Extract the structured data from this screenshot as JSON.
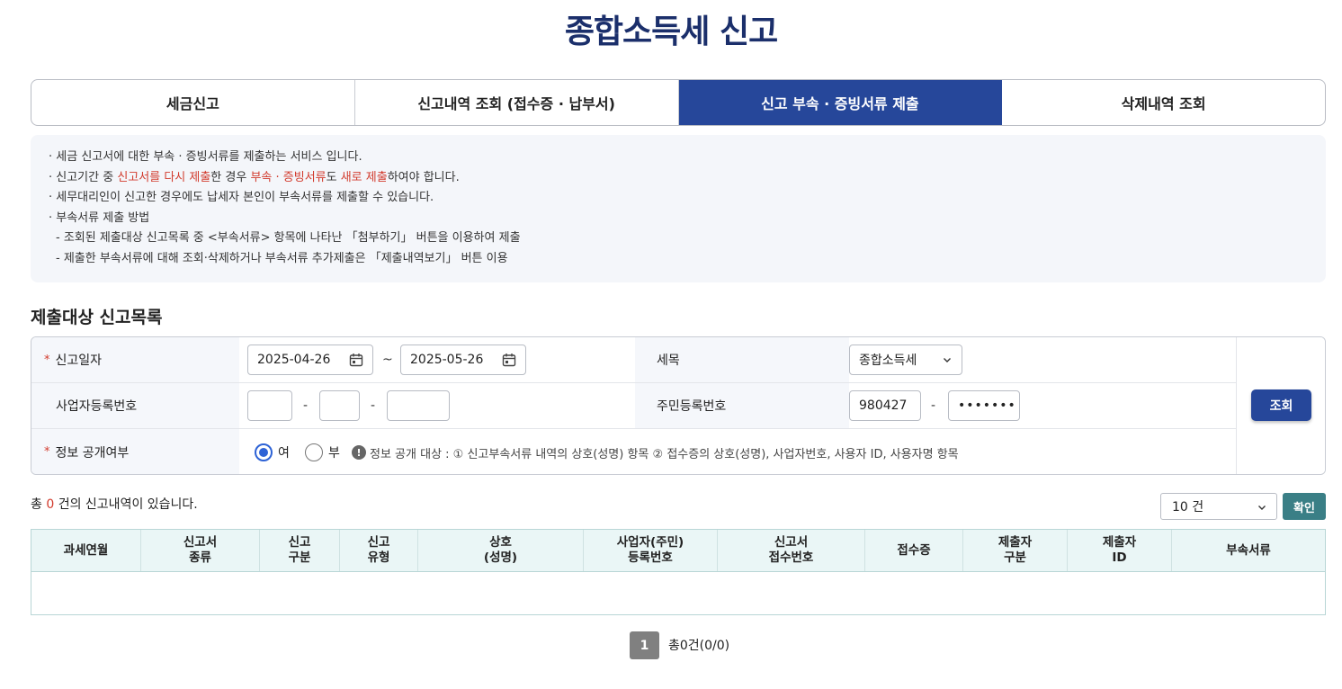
{
  "page_title": "종합소득세 신고",
  "tabs": [
    {
      "label": "세금신고"
    },
    {
      "label": "신고내역 조회 (접수증 · 납부서)"
    },
    {
      "label": "신고 부속 · 증빙서류 제출"
    },
    {
      "label": "삭제내역 조회"
    }
  ],
  "active_tab": 2,
  "info": {
    "line1": "· 세금 신고서에 대한 부속 · 증빙서류를 제출하는 서비스 입니다.",
    "line2_a": "· 신고기간 중 ",
    "line2_b": "신고서를 다시 제출",
    "line2_c": "한 경우 ",
    "line2_d": "부속 · 증빙서류",
    "line2_e": "도 ",
    "line2_f": "새로 제출",
    "line2_g": "하여야 합니다.",
    "line3": "· 세무대리인이 신고한 경우에도 납세자 본인이 부속서류를 제출할 수 있습니다.",
    "line4": "· 부속서류 제출 방법",
    "line5": "- 조회된 제출대상 신고목록 중 <부속서류> 항목에 나타난 「첨부하기」 버튼을 이용하여 제출",
    "line6": "- 제출한 부속서류에 대해 조회·삭제하거나 부속서류 추가제출은 「제출내역보기」 버튼 이용"
  },
  "section_title": "제출대상 신고목록",
  "search": {
    "required_mark": "*",
    "date_label": "신고일자",
    "date_from": "2025-04-26",
    "date_sep": "~",
    "date_to": "2025-05-26",
    "tax_item_label": "세목",
    "tax_item_value": "종합소득세",
    "biz_no_label": "사업자등록번호",
    "biz_no_1": "",
    "biz_no_2": "",
    "biz_no_3": "",
    "dash": "-",
    "resident_no_label": "주민등록번호",
    "resident_no_1": "980427",
    "resident_no_2": "•••••••",
    "disclosure_label": "정보 공개여부",
    "radio_yes": "여",
    "radio_no": "부",
    "disclosure_selected": "여",
    "notice_icon": "!",
    "notice_text": "정보 공개 대상 : ① 신고부속서류 내역의 상호(성명) 항목 ② 접수증의 상호(성명), 사업자번호, 사용자 ID, 사용자명 항목",
    "search_button": "조회"
  },
  "results": {
    "total_prefix": "총 ",
    "total_count": "0",
    "total_suffix": " 건의 신고내역이 있습니다.",
    "page_size": "10 건",
    "confirm_button": "확인"
  },
  "table": {
    "columns": [
      "과세연월",
      "신고서\n종류",
      "신고\n구분",
      "신고\n유형",
      "상호\n(성명)",
      "사업자(주민)\n등록번호",
      "신고서\n접수번호",
      "접수증",
      "제출자\n구분",
      "제출자\nID",
      "부속서류"
    ],
    "rows": []
  },
  "pagination": {
    "current_page": "1",
    "summary": "총0건(0/0)"
  },
  "colors": {
    "title": "#1b2f6b",
    "active_tab": "#26479a",
    "highlight_red": "#d23b2d",
    "confirm_button": "#3a7f86",
    "table_header_bg": "#eaf6f6"
  }
}
